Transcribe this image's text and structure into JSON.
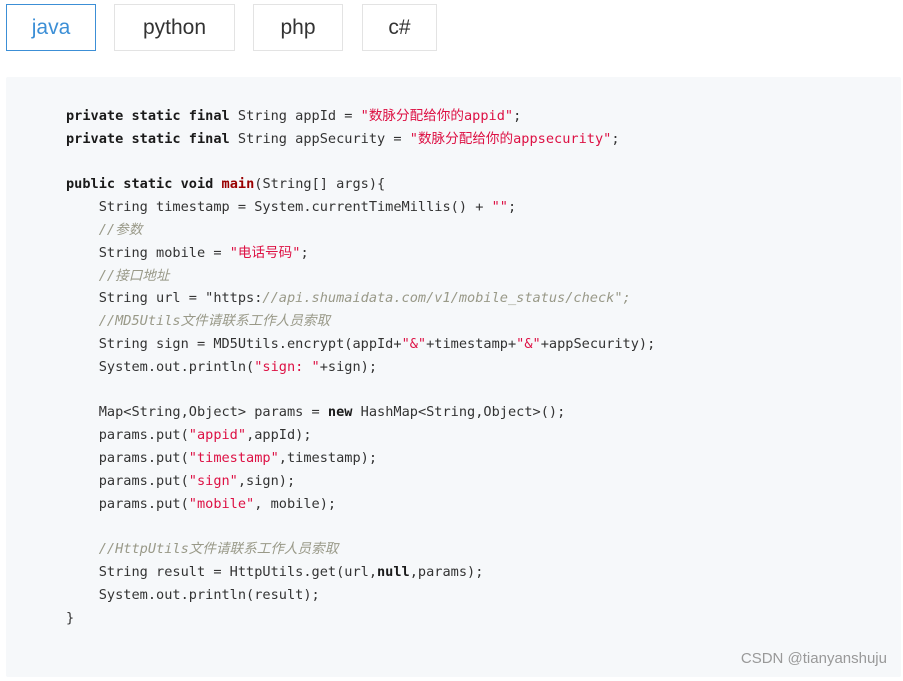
{
  "tabs": [
    {
      "label": "java",
      "active": true
    },
    {
      "label": "python",
      "active": false
    },
    {
      "label": "php",
      "active": false
    },
    {
      "label": "c#",
      "active": false
    }
  ],
  "colors": {
    "active_tab": "#3c8fd6",
    "code_background": "#f6f8fa",
    "string": "#d14",
    "comment": "#999988",
    "function": "#990000"
  },
  "code": {
    "language": "java",
    "lines": [
      "private static final String appId = \"数脉分配给你的appid\";",
      "private static final String appSecurity = \"数脉分配给你的appsecurity\";",
      "",
      "public static void main(String[] args){",
      "    String timestamp = System.currentTimeMillis() + \"\";",
      "    //参数",
      "    String mobile = \"电话号码\";",
      "    //接口地址",
      "    String url = \"https://api.shumaidata.com/v1/mobile_status/check\";",
      "    //MD5Utils文件请联系工作人员索取",
      "    String sign = MD5Utils.encrypt(appId+\"&\"+timestamp+\"&\"+appSecurity);",
      "    System.out.println(\"sign: \"+sign);",
      "",
      "    Map<String,Object> params = new HashMap<String,Object>();",
      "    params.put(\"appid\",appId);",
      "    params.put(\"timestamp\",timestamp);",
      "    params.put(\"sign\",sign);",
      "    params.put(\"mobile\", mobile);",
      "",
      "    //HttpUtils文件请联系工作人员索取",
      "    String result = HttpUtils.get(url,null,params);",
      "    System.out.println(result);",
      "}"
    ]
  },
  "watermark": "CSDN @tianyanshuju"
}
